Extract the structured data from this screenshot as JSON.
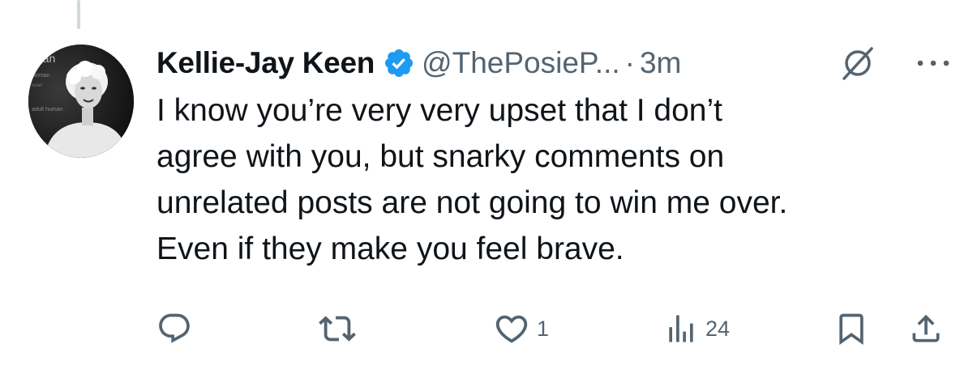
{
  "tweet": {
    "display_name": "Kellie-Jay Keen",
    "handle": "@ThePosieP...",
    "separator": "·",
    "timestamp": "3m",
    "verified": true,
    "text_lines": [
      "I know you’re very very upset that I don’t",
      "agree with you, but snarky comments on",
      "unrelated posts are not going to win me over.",
      "Even if they make you feel brave."
    ],
    "avatar_print": [
      "man",
      "woman",
      "noun",
      "adult human"
    ]
  },
  "actions": {
    "reply_count": "",
    "repost_count": "",
    "like_count": "1",
    "views_count": "24"
  },
  "icons": [
    "reply-icon",
    "repost-icon",
    "like-icon",
    "views-icon",
    "bookmark-icon",
    "share-icon",
    "grok-icon",
    "more-icon",
    "verified-icon"
  ],
  "colors": {
    "text": "#0f1419",
    "secondary": "#536471",
    "verified": "#1d9bf0",
    "thread_line": "#cfd9de"
  }
}
